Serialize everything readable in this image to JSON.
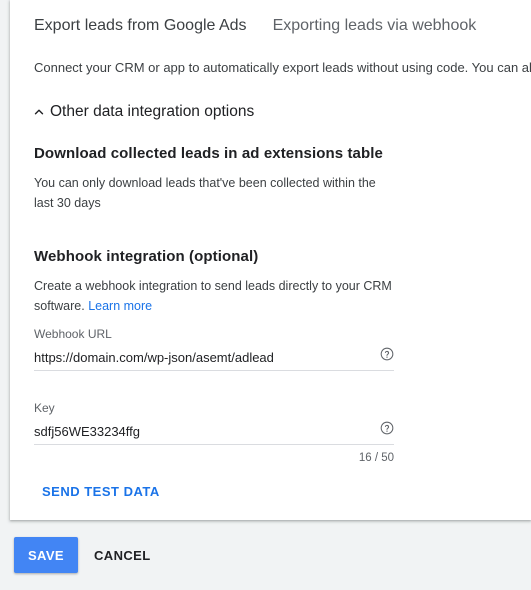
{
  "tabs": [
    {
      "label": "Export leads from Google Ads",
      "active": true
    },
    {
      "label": "Exporting leads via webhook",
      "active": false
    }
  ],
  "intro_text": "Connect your CRM or app to automatically export leads without using code. You can also",
  "other_options": {
    "label": "Other data integration options",
    "icon": "chevron-up-icon"
  },
  "download_section": {
    "title": "Download collected leads in ad extensions table",
    "description": "You can only download leads that've been collected within the last 30 days"
  },
  "webhook_section": {
    "title": "Webhook integration (optional)",
    "description": "Create a webhook integration to send leads directly to your CRM software.",
    "learn_more": "Learn more",
    "url_field": {
      "label": "Webhook URL",
      "value": "https://domain.com/wp-json/asemt/adlead",
      "icon": "help-circle-icon"
    },
    "key_field": {
      "label": "Key",
      "value": "sdfj56WE33234ffg",
      "counter": "16 / 50",
      "icon": "help-circle-icon"
    },
    "send_test_label": "SEND TEST DATA"
  },
  "actions": {
    "save_label": "SAVE",
    "cancel_label": "CANCEL"
  },
  "colors": {
    "accent": "#1a73e8",
    "primary_button": "#4285f4",
    "background": "#f1f3f4"
  }
}
